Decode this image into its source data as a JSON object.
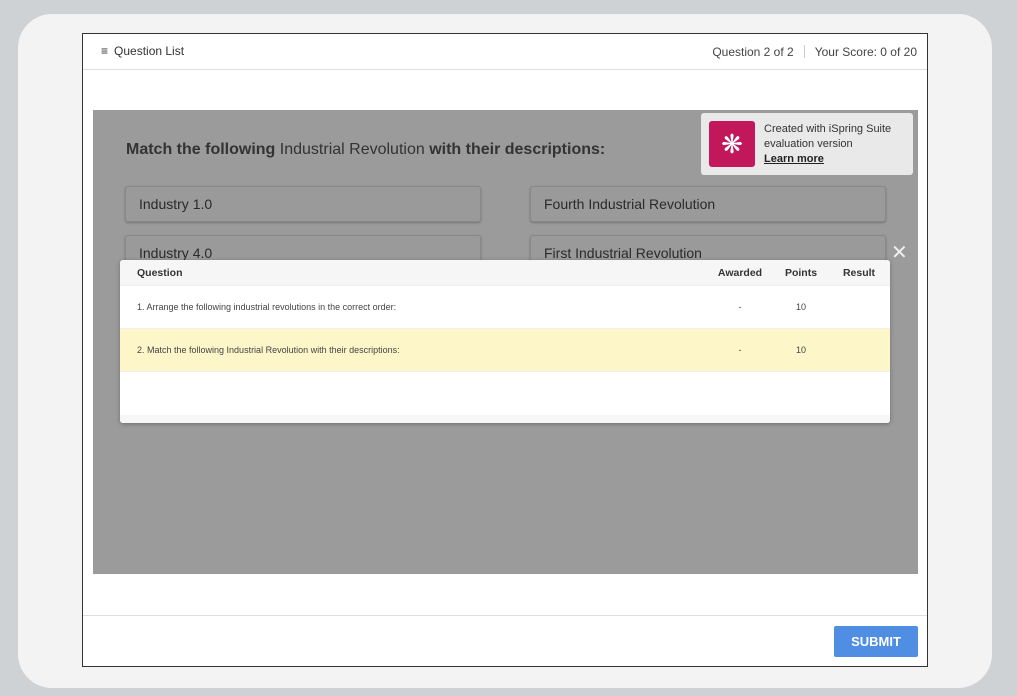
{
  "header": {
    "question_list": "Question List",
    "progress": "Question 2 of 2",
    "score": "Your Score: 0 of 20"
  },
  "question": {
    "title_bold1": "Match the following",
    "title_normal": "Industrial Revolution",
    "title_bold2": "with their descriptions:",
    "left": [
      "Industry 1.0",
      "Industry 4.0"
    ],
    "right": [
      "Fourth Industrial Revolution",
      "First Industrial Revolution"
    ]
  },
  "watermark": {
    "line1": "Created with iSpring Suite",
    "line2": "evaluation version",
    "link": "Learn more"
  },
  "table": {
    "headers": [
      "Question",
      "Awarded",
      "Points",
      "Result"
    ],
    "rows": [
      {
        "question": "1. Arrange the following industrial revolutions in the correct order:",
        "awarded": "-",
        "points": "10",
        "result": ""
      },
      {
        "question": "2. Match the following Industrial Revolution with their descriptions:",
        "awarded": "-",
        "points": "10",
        "result": ""
      }
    ]
  },
  "footer": {
    "submit": "SUBMIT"
  },
  "colors": {
    "accent": "#4f8ee3",
    "highlight": "#fdf6c8",
    "brand": "#c2185b"
  }
}
